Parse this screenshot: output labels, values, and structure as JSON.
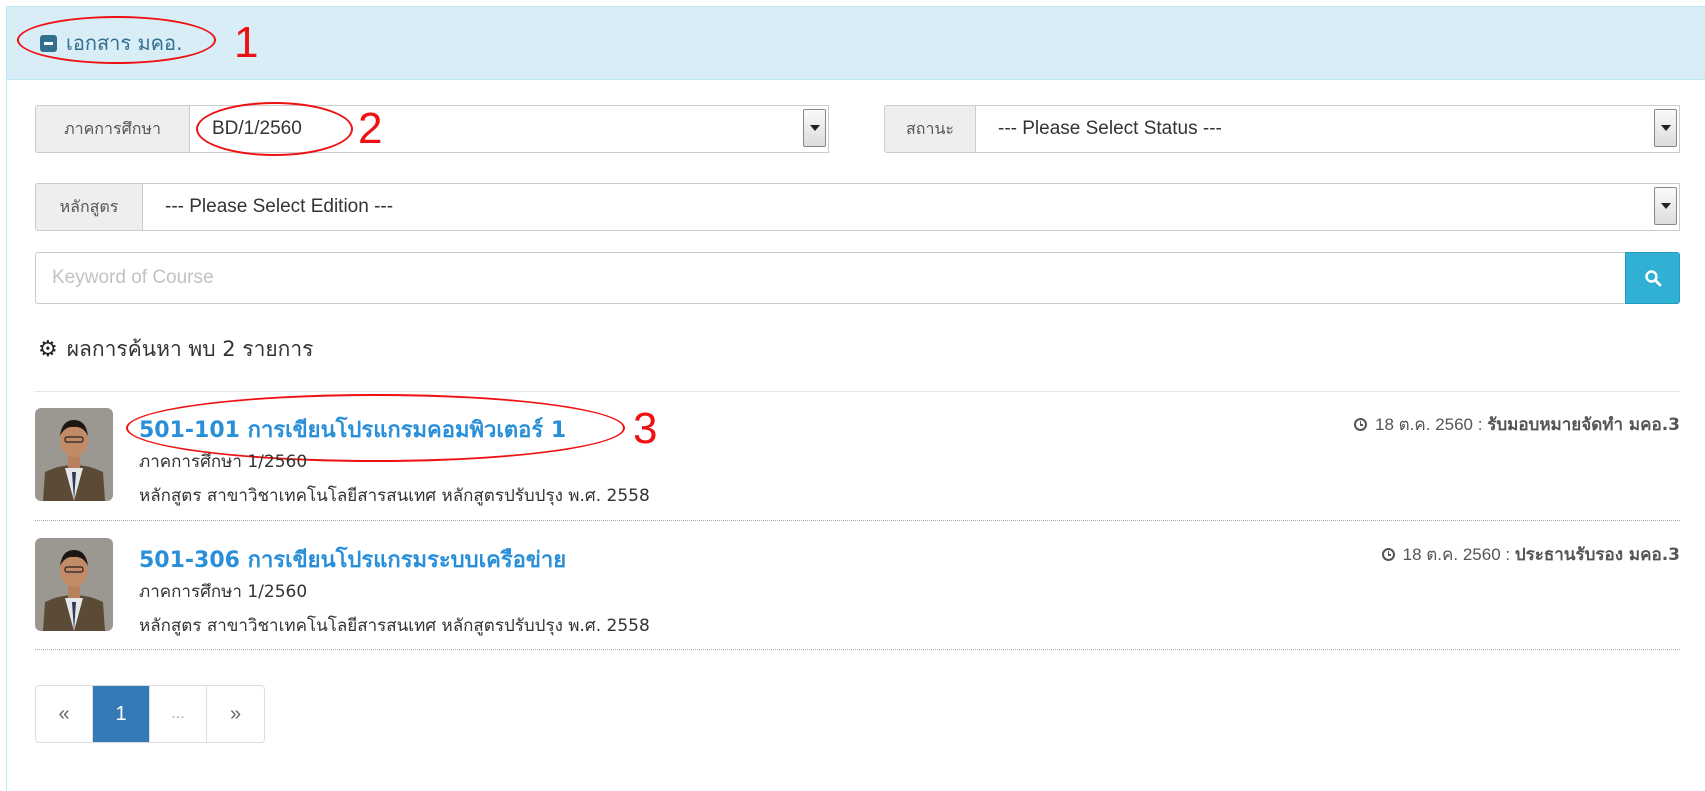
{
  "panel": {
    "title": "เอกสาร มคอ."
  },
  "annotations": [
    "1",
    "2",
    "3"
  ],
  "filters": {
    "semester": {
      "label": "ภาคการศึกษา",
      "value": "BD/1/2560"
    },
    "status": {
      "label": "สถานะ",
      "value": "--- Please Select Status ---"
    },
    "curriculum": {
      "label": "หลักสูตร",
      "value": "--- Please Select Edition ---"
    }
  },
  "search": {
    "placeholder": "Keyword of Course",
    "button_icon": "search-icon"
  },
  "results": {
    "summary": "ผลการค้นหา พบ 2 รายการ",
    "items": [
      {
        "title": "501-101 การเขียนโปรแกรมคอมพิวเตอร์ 1",
        "semester": "ภาคการศึกษา 1/2560",
        "curriculum": "หลักสูตร สาขาวิชาเทคโนโลยีสารสนเทศ หลักสูตรปรับปรุง พ.ศ. 2558",
        "date": "18 ต.ค. 2560 :",
        "status": "รับมอบหมายจัดทำ มคอ.3"
      },
      {
        "title": "501-306 การเขียนโปรแกรมระบบเครือข่าย",
        "semester": "ภาคการศึกษา 1/2560",
        "curriculum": "หลักสูตร สาขาวิชาเทคโนโลยีสารสนเทศ หลักสูตรปรับปรุง พ.ศ. 2558",
        "date": "18 ต.ค. 2560 :",
        "status": "ประธานรับรอง มคอ.3"
      }
    ]
  },
  "pagination": {
    "prev": "«",
    "current": "1",
    "ellipsis": "...",
    "next": "»"
  },
  "colors": {
    "heading_bg": "#d9edf7",
    "heading_text": "#31708f",
    "link": "#2a8fd9",
    "search_button": "#31b0d5",
    "annotation": "#ee1111",
    "active_page": "#337ab7"
  }
}
